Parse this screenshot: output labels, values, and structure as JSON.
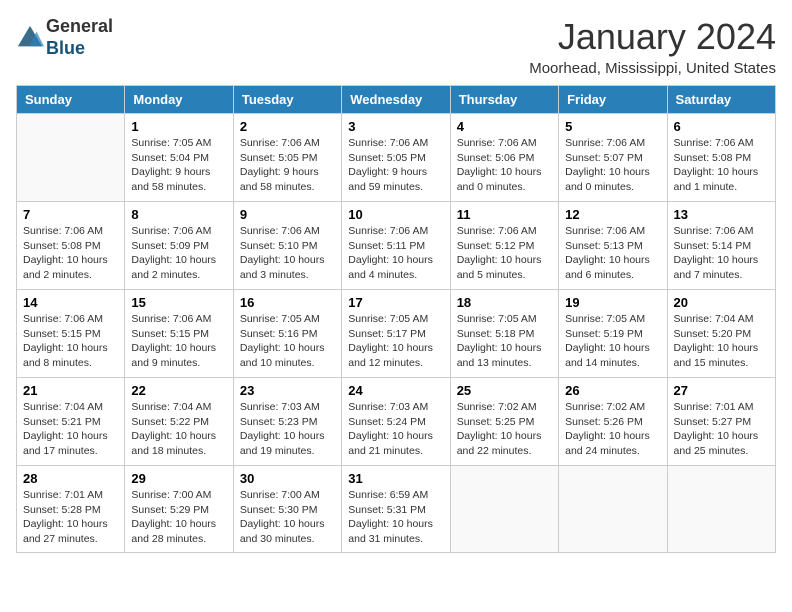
{
  "header": {
    "logo": {
      "line1": "General",
      "line2": "Blue"
    },
    "title": "January 2024",
    "location": "Moorhead, Mississippi, United States"
  },
  "weekdays": [
    "Sunday",
    "Monday",
    "Tuesday",
    "Wednesday",
    "Thursday",
    "Friday",
    "Saturday"
  ],
  "weeks": [
    [
      {
        "day": "",
        "info": ""
      },
      {
        "day": "1",
        "info": "Sunrise: 7:05 AM\nSunset: 5:04 PM\nDaylight: 9 hours\nand 58 minutes."
      },
      {
        "day": "2",
        "info": "Sunrise: 7:06 AM\nSunset: 5:05 PM\nDaylight: 9 hours\nand 58 minutes."
      },
      {
        "day": "3",
        "info": "Sunrise: 7:06 AM\nSunset: 5:05 PM\nDaylight: 9 hours\nand 59 minutes."
      },
      {
        "day": "4",
        "info": "Sunrise: 7:06 AM\nSunset: 5:06 PM\nDaylight: 10 hours\nand 0 minutes."
      },
      {
        "day": "5",
        "info": "Sunrise: 7:06 AM\nSunset: 5:07 PM\nDaylight: 10 hours\nand 0 minutes."
      },
      {
        "day": "6",
        "info": "Sunrise: 7:06 AM\nSunset: 5:08 PM\nDaylight: 10 hours\nand 1 minute."
      }
    ],
    [
      {
        "day": "7",
        "info": "Sunrise: 7:06 AM\nSunset: 5:08 PM\nDaylight: 10 hours\nand 2 minutes."
      },
      {
        "day": "8",
        "info": "Sunrise: 7:06 AM\nSunset: 5:09 PM\nDaylight: 10 hours\nand 2 minutes."
      },
      {
        "day": "9",
        "info": "Sunrise: 7:06 AM\nSunset: 5:10 PM\nDaylight: 10 hours\nand 3 minutes."
      },
      {
        "day": "10",
        "info": "Sunrise: 7:06 AM\nSunset: 5:11 PM\nDaylight: 10 hours\nand 4 minutes."
      },
      {
        "day": "11",
        "info": "Sunrise: 7:06 AM\nSunset: 5:12 PM\nDaylight: 10 hours\nand 5 minutes."
      },
      {
        "day": "12",
        "info": "Sunrise: 7:06 AM\nSunset: 5:13 PM\nDaylight: 10 hours\nand 6 minutes."
      },
      {
        "day": "13",
        "info": "Sunrise: 7:06 AM\nSunset: 5:14 PM\nDaylight: 10 hours\nand 7 minutes."
      }
    ],
    [
      {
        "day": "14",
        "info": "Sunrise: 7:06 AM\nSunset: 5:15 PM\nDaylight: 10 hours\nand 8 minutes."
      },
      {
        "day": "15",
        "info": "Sunrise: 7:06 AM\nSunset: 5:15 PM\nDaylight: 10 hours\nand 9 minutes."
      },
      {
        "day": "16",
        "info": "Sunrise: 7:05 AM\nSunset: 5:16 PM\nDaylight: 10 hours\nand 10 minutes."
      },
      {
        "day": "17",
        "info": "Sunrise: 7:05 AM\nSunset: 5:17 PM\nDaylight: 10 hours\nand 12 minutes."
      },
      {
        "day": "18",
        "info": "Sunrise: 7:05 AM\nSunset: 5:18 PM\nDaylight: 10 hours\nand 13 minutes."
      },
      {
        "day": "19",
        "info": "Sunrise: 7:05 AM\nSunset: 5:19 PM\nDaylight: 10 hours\nand 14 minutes."
      },
      {
        "day": "20",
        "info": "Sunrise: 7:04 AM\nSunset: 5:20 PM\nDaylight: 10 hours\nand 15 minutes."
      }
    ],
    [
      {
        "day": "21",
        "info": "Sunrise: 7:04 AM\nSunset: 5:21 PM\nDaylight: 10 hours\nand 17 minutes."
      },
      {
        "day": "22",
        "info": "Sunrise: 7:04 AM\nSunset: 5:22 PM\nDaylight: 10 hours\nand 18 minutes."
      },
      {
        "day": "23",
        "info": "Sunrise: 7:03 AM\nSunset: 5:23 PM\nDaylight: 10 hours\nand 19 minutes."
      },
      {
        "day": "24",
        "info": "Sunrise: 7:03 AM\nSunset: 5:24 PM\nDaylight: 10 hours\nand 21 minutes."
      },
      {
        "day": "25",
        "info": "Sunrise: 7:02 AM\nSunset: 5:25 PM\nDaylight: 10 hours\nand 22 minutes."
      },
      {
        "day": "26",
        "info": "Sunrise: 7:02 AM\nSunset: 5:26 PM\nDaylight: 10 hours\nand 24 minutes."
      },
      {
        "day": "27",
        "info": "Sunrise: 7:01 AM\nSunset: 5:27 PM\nDaylight: 10 hours\nand 25 minutes."
      }
    ],
    [
      {
        "day": "28",
        "info": "Sunrise: 7:01 AM\nSunset: 5:28 PM\nDaylight: 10 hours\nand 27 minutes."
      },
      {
        "day": "29",
        "info": "Sunrise: 7:00 AM\nSunset: 5:29 PM\nDaylight: 10 hours\nand 28 minutes."
      },
      {
        "day": "30",
        "info": "Sunrise: 7:00 AM\nSunset: 5:30 PM\nDaylight: 10 hours\nand 30 minutes."
      },
      {
        "day": "31",
        "info": "Sunrise: 6:59 AM\nSunset: 5:31 PM\nDaylight: 10 hours\nand 31 minutes."
      },
      {
        "day": "",
        "info": ""
      },
      {
        "day": "",
        "info": ""
      },
      {
        "day": "",
        "info": ""
      }
    ]
  ]
}
